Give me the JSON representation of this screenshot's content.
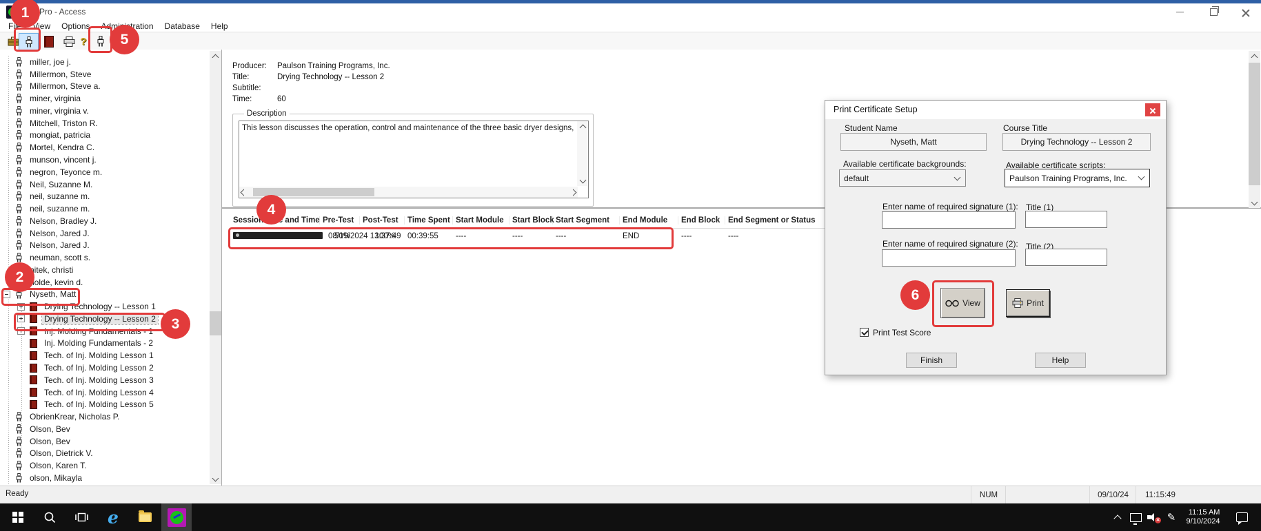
{
  "window": {
    "title": "Pro - Access"
  },
  "menu": {
    "items": [
      "File",
      "View",
      "Options",
      "Administration",
      "Database",
      "Help"
    ]
  },
  "toolbar": {
    "help_glyph": "?"
  },
  "tree": {
    "items": [
      {
        "kind": "student",
        "label": "miller, joe j.",
        "expander": "none"
      },
      {
        "kind": "student",
        "label": "Millermon, Steve",
        "expander": "none"
      },
      {
        "kind": "student",
        "label": "Millermon, Steve a.",
        "expander": "none"
      },
      {
        "kind": "student",
        "label": "miner, virginia",
        "expander": "none"
      },
      {
        "kind": "student",
        "label": "miner, virginia v.",
        "expander": "none"
      },
      {
        "kind": "student",
        "label": "Mitchell, Triston R.",
        "expander": "none"
      },
      {
        "kind": "student",
        "label": "mongiat, patricia",
        "expander": "none"
      },
      {
        "kind": "student",
        "label": "Mortel, Kendra C.",
        "expander": "none"
      },
      {
        "kind": "student",
        "label": "munson, vincent j.",
        "expander": "none"
      },
      {
        "kind": "student",
        "label": "negron, Teyonce m.",
        "expander": "none"
      },
      {
        "kind": "student",
        "label": "Neil, Suzanne M.",
        "expander": "none"
      },
      {
        "kind": "student",
        "label": "neil, suzanne m.",
        "expander": "none"
      },
      {
        "kind": "student",
        "label": "neil, suzanne m.",
        "expander": "none"
      },
      {
        "kind": "student",
        "label": "Nelson, Bradley J.",
        "expander": "none"
      },
      {
        "kind": "student",
        "label": "Nelson, Jared J.",
        "expander": "none"
      },
      {
        "kind": "student",
        "label": "Nelson, Jared J.",
        "expander": "none"
      },
      {
        "kind": "student",
        "label": "neuman, scott s.",
        "expander": "none"
      },
      {
        "kind": "student",
        "label": "nitek, christi",
        "expander": "none"
      },
      {
        "kind": "student",
        "label": "nolde, kevin d.",
        "expander": "none"
      },
      {
        "kind": "student",
        "label": "Nyseth, Matt",
        "expander": "minus"
      },
      {
        "kind": "lesson",
        "label": "Drying Technology -- Lesson 1",
        "expander": "plus"
      },
      {
        "kind": "lesson",
        "label": "Drying Technology -- Lesson 2",
        "expander": "plus",
        "selected": true
      },
      {
        "kind": "lesson",
        "label": "Inj. Molding Fundamentals - 1",
        "expander": "plus"
      },
      {
        "kind": "lesson",
        "label": "Inj. Molding Fundamentals - 2",
        "expander": "none"
      },
      {
        "kind": "lesson",
        "label": "Tech. of Inj. Molding Lesson 1",
        "expander": "none"
      },
      {
        "kind": "lesson",
        "label": "Tech. of Inj. Molding Lesson 2",
        "expander": "none"
      },
      {
        "kind": "lesson",
        "label": "Tech. of Inj. Molding Lesson 3",
        "expander": "none"
      },
      {
        "kind": "lesson",
        "label": "Tech. of Inj. Molding Lesson 4",
        "expander": "none"
      },
      {
        "kind": "lesson",
        "label": "Tech. of Inj. Molding Lesson 5",
        "expander": "none"
      },
      {
        "kind": "student",
        "label": "ObrienKrear, Nicholas P.",
        "expander": "none"
      },
      {
        "kind": "student",
        "label": "Olson, Bev",
        "expander": "none"
      },
      {
        "kind": "student",
        "label": "Olson, Bev",
        "expander": "none"
      },
      {
        "kind": "student",
        "label": "Olson, Dietrick V.",
        "expander": "none"
      },
      {
        "kind": "student",
        "label": "Olson, Karen T.",
        "expander": "none"
      },
      {
        "kind": "student",
        "label": "olson, Mikayla",
        "expander": "none"
      }
    ]
  },
  "details": {
    "producer_label": "Producer:",
    "producer": "Paulson Training Programs, Inc.",
    "title_label": "Title:",
    "title": "Drying Technology -- Lesson 2",
    "subtitle_label": "Subtitle:",
    "subtitle": "",
    "time_label": "Time:",
    "time": "60",
    "description_label": "Description",
    "description": "This lesson discusses the operation, control and maintenance of the three basic dryer designs, hot air, desicca"
  },
  "sessions": {
    "columns": [
      "Session Date and Time",
      "Pre-Test",
      "Post-Test",
      "Time Spent",
      "Start Module",
      "Start Block",
      "Start Segment",
      "End Module",
      "End Block",
      "End Segment or Status"
    ],
    "row": {
      "datetime": "08/19/2024 13:37:49",
      "pre_test": "50%",
      "post_test": "100%",
      "time_spent": "00:39:55",
      "start_module": "----",
      "start_block": "----",
      "start_segment": "----",
      "end_module": "END",
      "end_block": "----",
      "end_status": "----"
    }
  },
  "dialog": {
    "title": "Print Certificate Setup",
    "student_label": "Student Name",
    "student": "Nyseth, Matt",
    "course_label": "Course Title",
    "course": "Drying Technology -- Lesson 2",
    "backgrounds_label": "Available certificate backgrounds:",
    "background": "default",
    "scripts_label": "Available certificate scripts:",
    "script": "Paulson Training Programs, Inc.",
    "sig1_label": "Enter name of required signature (1):",
    "sig1": "",
    "title1_label": "Title (1)",
    "title1": "",
    "sig2_label": "Enter name of required signature (2):",
    "sig2": "",
    "title2_label": "Title (2)",
    "title2": "",
    "view_label": "View",
    "print_label": "Print",
    "checkbox_label": "Print Test Score",
    "finish_label": "Finish",
    "help_label": "Help"
  },
  "status": {
    "ready": "Ready",
    "num": "NUM",
    "date": "09/10/24",
    "time": "11:15:49"
  },
  "taskbar": {
    "clock_time": "11:15 AM",
    "clock_date": "9/10/2024",
    "ie_glyph": "e",
    "pen_glyph": "✎"
  },
  "annotations": {
    "n1": "1",
    "n2": "2",
    "n3": "3",
    "n4": "4",
    "n5": "5",
    "n6": "6"
  },
  "colors": {
    "annotation_red": "#e23b3b",
    "accent_blue": "#2e5fa5",
    "book_red": "#8c1c12"
  }
}
